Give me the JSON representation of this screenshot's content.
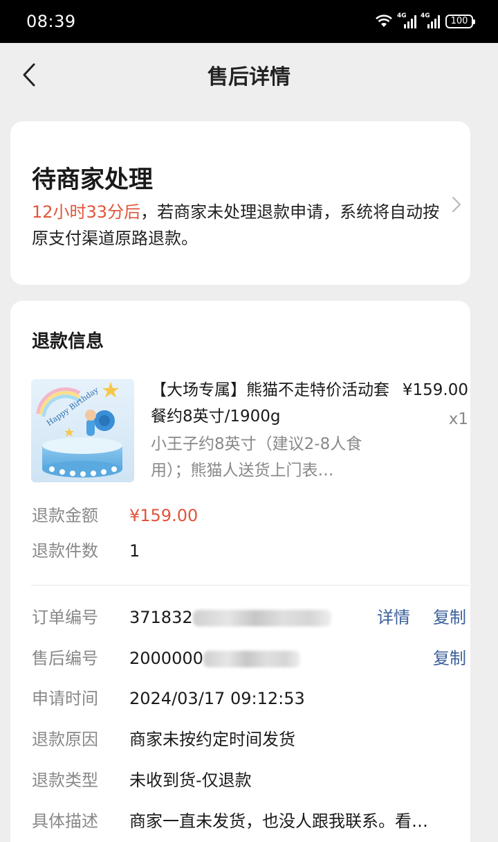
{
  "status_bar": {
    "time": "08:39",
    "battery": "100",
    "signal1": "4G",
    "signal2": "4G"
  },
  "nav": {
    "title": "售后详情"
  },
  "status_card": {
    "title": "待商家处理",
    "countdown": "12小时33分后",
    "desc": "，若商家未处理退款申请，系统将自动按原支付渠道原路退款。"
  },
  "refund_info": {
    "section_title": "退款信息",
    "product": {
      "name": "【大场专属】熊猫不走特价活动套餐约8英寸/1900g",
      "spec": "小王子约8英寸（建议2-8人食用）；熊猫人送货上门表…",
      "price": "¥159.00",
      "qty": "x1",
      "image_text": "Happy Birthday"
    },
    "amount_label": "退款金额",
    "amount_value": "¥159.00",
    "count_label": "退款件数",
    "count_value": "1",
    "order_no_label": "订单编号",
    "order_no_value": "371832",
    "after_sale_no_label": "售后编号",
    "after_sale_no_value": "2000000",
    "apply_time_label": "申请时间",
    "apply_time_value": "2024/03/17 09:12:53",
    "reason_label": "退款原因",
    "reason_value": "商家未按约定时间发货",
    "type_label": "退款类型",
    "type_value": "未收到货-仅退款",
    "desc_label": "具体描述",
    "desc_value": "商家一直未发货，也没人跟我联系。看…",
    "detail_link": "详情",
    "copy_link": "复制",
    "copy_link2": "复制"
  },
  "colors": {
    "accent_red": "#e0553a",
    "link_blue": "#3a5f9a",
    "background": "#eeeeee"
  }
}
